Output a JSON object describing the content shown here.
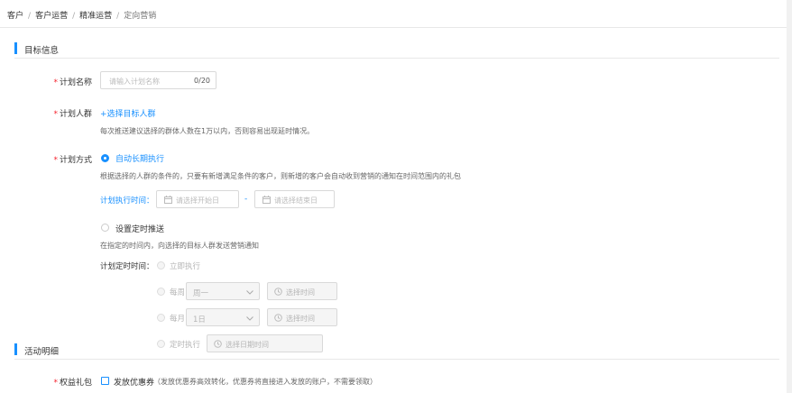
{
  "breadcrumb": [
    "客户",
    "客户运营",
    "精准运营",
    "定向营销"
  ],
  "section_target": "目标信息",
  "plan_name": {
    "label": "计划名称",
    "placeholder": "请输入计划名称",
    "count": "0/20"
  },
  "plan_crowd": {
    "label": "计划人群",
    "link": "+选择目标人群",
    "hint": "每次推送建议选择的群体人数在1万以内，否则容易出现延时情况。"
  },
  "plan_method": {
    "label": "计划方式",
    "option_long": "自动长期执行",
    "long_desc": "根据选择的人群的条件的，只要有新增满足条件的客户，则新增的客户会自动收到营销的通知在时间范围内的礼包",
    "exec_time_label": "计划执行时间：",
    "start_placeholder": "请选择开始日",
    "dash": "-",
    "end_placeholder": "请选择结束日",
    "option_timed": "设置定时推送",
    "timed_desc": "在指定的时间内，向选择的目标人群发送营销通知",
    "timed_label": "计划定时时间：",
    "immediate": "立即执行",
    "weekly": "每周",
    "weekly_value": "周一",
    "monthly": "每月",
    "monthly_value": "1日",
    "select_time": "选择时间",
    "scheduled": "定时执行",
    "select_datetime": "选择日期时间"
  },
  "section_activity": "活动明细",
  "benefit": {
    "label": "权益礼包",
    "option": "发放优惠券",
    "note": "（发放优惠券高效转化，优惠券将直接进入发放的账户，不需要领取）"
  },
  "colors": {
    "primary": "#1890ff",
    "required": "#f5222d",
    "border": "#d9d9d9",
    "disabled_bg": "#f5f5f5"
  }
}
